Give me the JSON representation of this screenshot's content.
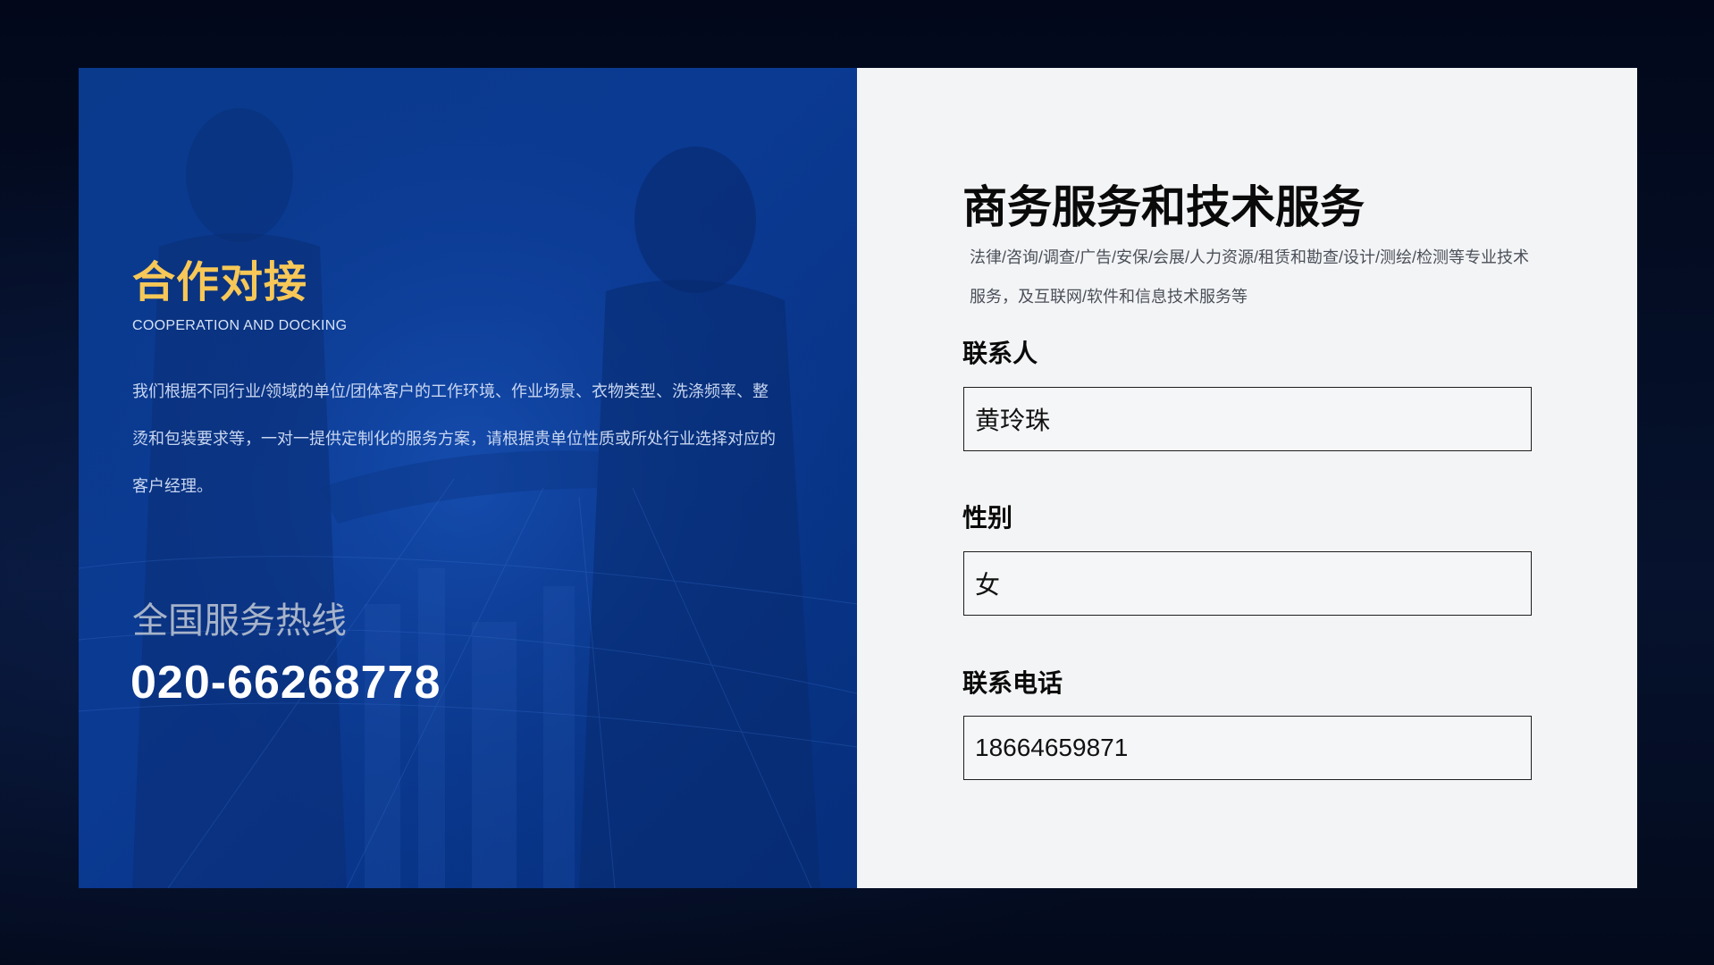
{
  "colors": {
    "accent_yellow": "#f7c857",
    "left_panel_blue": "#0b3a93",
    "right_panel_bg": "#f3f4f6",
    "page_bg": "#030a1c"
  },
  "left": {
    "title": "合作对接",
    "subtitle": "COOPERATION AND DOCKING",
    "description": "我们根据不同行业/领域的单位/团体客户的工作环境、作业场景、衣物类型、洗涤频率、整烫和包装要求等，一对一提供定制化的服务方案，请根据贵单位性质或所处行业选择对应的客户经理。",
    "hotline_label": "全国服务热线",
    "hotline_number": "020-66268778"
  },
  "right": {
    "title": "商务服务和技术服务",
    "description": "法律/咨询/调查/广告/安保/会展/人力资源/租赁和勘查/设计/测绘/检测等专业技术服务，及互联网/软件和信息技术服务等",
    "fields": [
      {
        "label": "联系人",
        "value": "黄玲珠"
      },
      {
        "label": "性别",
        "value": "女"
      },
      {
        "label": "联系电话",
        "value": "18664659871"
      }
    ]
  }
}
